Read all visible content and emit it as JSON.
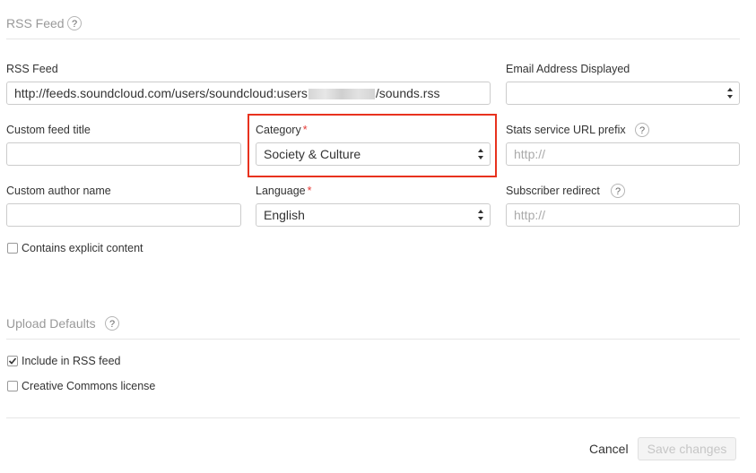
{
  "rss_section": {
    "title": "RSS Feed",
    "help_icon": "question-icon",
    "help_glyph": "?"
  },
  "rss_feed": {
    "label": "RSS Feed",
    "url_prefix": "http://feeds.soundcloud.com/users/soundcloud:users",
    "url_suffix": "/sounds.rss"
  },
  "email_displayed": {
    "label": "Email Address Displayed",
    "value": ""
  },
  "custom_feed_title": {
    "label": "Custom feed title",
    "value": ""
  },
  "category": {
    "label": "Category",
    "required_mark": "*",
    "value": "Society & Culture"
  },
  "stats_prefix": {
    "label": "Stats service URL prefix",
    "placeholder": "http://"
  },
  "custom_author": {
    "label": "Custom author name",
    "value": ""
  },
  "language": {
    "label": "Language",
    "required_mark": "*",
    "value": "English"
  },
  "subscriber_redirect": {
    "label": "Subscriber redirect",
    "placeholder": "http://"
  },
  "explicit": {
    "label": "Contains explicit content",
    "checked": false
  },
  "upload_section": {
    "title": "Upload Defaults"
  },
  "include_rss": {
    "label": "Include in RSS feed",
    "checked": true
  },
  "creative_commons": {
    "label": "Creative Commons license",
    "checked": false
  },
  "footer": {
    "cancel_label": "Cancel",
    "save_label": "Save changes"
  },
  "colors": {
    "highlight": "#e8321e",
    "required": "#e53935",
    "section_title": "#999999"
  }
}
